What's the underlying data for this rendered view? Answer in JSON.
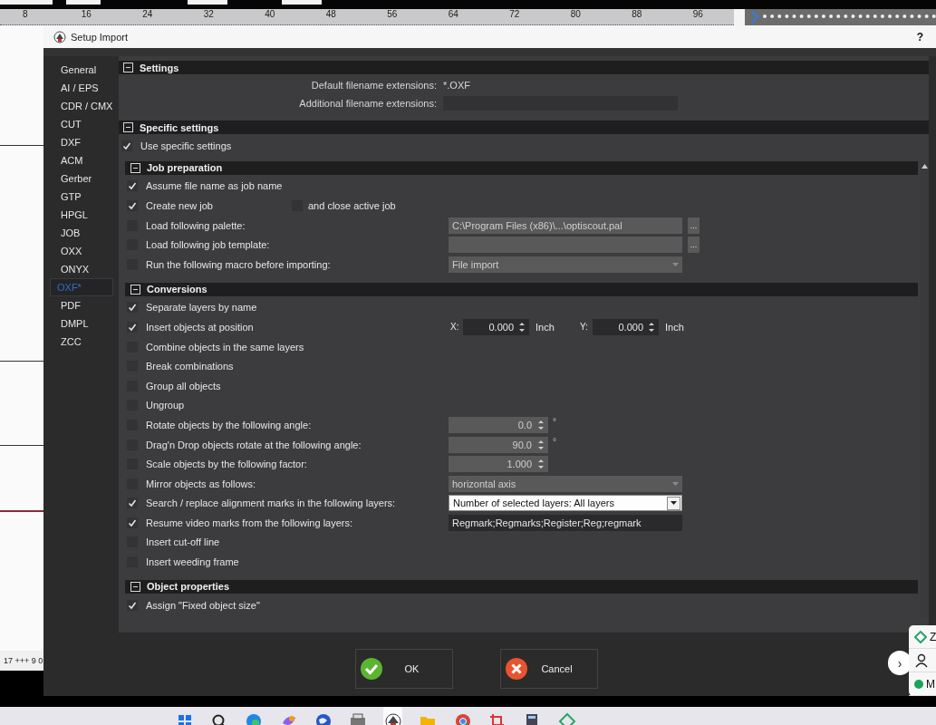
{
  "app": {
    "ruler_labels": [
      "8",
      "16",
      "24",
      "32",
      "40",
      "48",
      "56",
      "64",
      "72",
      "80",
      "88",
      "96"
    ],
    "status_text": "17 +++ 9 0"
  },
  "dialog": {
    "title": "Setup Import",
    "help": "?",
    "sidebar": [
      {
        "label": "General",
        "selected": false
      },
      {
        "label": "AI / EPS",
        "selected": false
      },
      {
        "label": "CDR / CMX",
        "selected": false
      },
      {
        "label": "CUT",
        "selected": false
      },
      {
        "label": "DXF",
        "selected": false
      },
      {
        "label": "ACM",
        "selected": false
      },
      {
        "label": "Gerber",
        "selected": false
      },
      {
        "label": "GTP",
        "selected": false
      },
      {
        "label": "HPGL",
        "selected": false
      },
      {
        "label": "JOB",
        "selected": false
      },
      {
        "label": "OXX",
        "selected": false
      },
      {
        "label": "ONYX",
        "selected": false
      },
      {
        "label": "OXF*",
        "selected": true
      },
      {
        "label": "PDF",
        "selected": false
      },
      {
        "label": "DMPL",
        "selected": false
      },
      {
        "label": "ZCC",
        "selected": false
      }
    ],
    "sections": [
      {
        "title": "Settings",
        "expanded": true,
        "rows": [
          {
            "kind": "info",
            "label": "Default filename extensions:",
            "value": "*.OXF"
          },
          {
            "kind": "field",
            "label": "Additional filename extensions:"
          }
        ]
      },
      {
        "title": "Specific settings",
        "expanded": true,
        "rows": [
          {
            "kind": "check",
            "label": "Use specific settings",
            "checked": true
          }
        ],
        "children": [
          {
            "title": "Job preparation",
            "expanded": true,
            "rows": [
              {
                "kind": "check",
                "label": "Assume file name as job name",
                "checked": true
              },
              {
                "kind": "check",
                "label": "Create new job",
                "checked": true,
                "extra": {
                  "label": "and close active job",
                  "checked": false
                }
              },
              {
                "kind": "check",
                "label": "Load following palette:",
                "checked": false,
                "control": {
                  "kind": "path",
                  "value": "C:\\Program Files (x86)\\...\\optiscout.pal",
                  "button": "...",
                  "disabled": true
                }
              },
              {
                "kind": "check",
                "label": "Load following job template:",
                "checked": false,
                "control": {
                  "kind": "path",
                  "button": "...",
                  "disabled": true
                }
              },
              {
                "kind": "check",
                "label": "Run the following macro before importing:",
                "checked": false,
                "control": {
                  "kind": "dropdown",
                  "value": "File import",
                  "disabled": true
                }
              }
            ]
          },
          {
            "title": "Conversions",
            "expanded": true,
            "rows": [
              {
                "kind": "check",
                "label": "Separate layers by name",
                "checked": true
              },
              {
                "kind": "check",
                "label": "Insert objects at position",
                "checked": true,
                "control": {
                  "kind": "xy",
                  "fields": [
                    {
                      "label": "X:",
                      "value": "0.000",
                      "unit": "Inch"
                    },
                    {
                      "label": "Y:",
                      "value": "0.000",
                      "unit": "Inch"
                    }
                  ]
                }
              },
              {
                "kind": "check",
                "label": "Combine objects in the same layers",
                "checked": false
              },
              {
                "kind": "check",
                "label": "Break combinations",
                "checked": false
              },
              {
                "kind": "check",
                "label": "Group all objects",
                "checked": false
              },
              {
                "kind": "check",
                "label": "Ungroup",
                "checked": false
              },
              {
                "kind": "check",
                "label": "Rotate objects by the following angle:",
                "checked": false,
                "control": {
                  "kind": "spin",
                  "value": "0.0",
                  "unit": "°",
                  "disabled": true
                }
              },
              {
                "kind": "check",
                "label": "Drag'n Drop objects rotate at the following angle:",
                "checked": false,
                "control": {
                  "kind": "spin",
                  "value": "90.0",
                  "unit": "°",
                  "disabled": true
                }
              },
              {
                "kind": "check",
                "label": "Scale objects by the following factor:",
                "checked": false,
                "control": {
                  "kind": "spin",
                  "value": "1.000",
                  "disabled": true
                }
              },
              {
                "kind": "check",
                "label": "Mirror objects as follows:",
                "checked": false,
                "control": {
                  "kind": "dropdown",
                  "value": "horizontal axis",
                  "disabled": true
                }
              },
              {
                "kind": "check",
                "label": "Search / replace alignment marks in the following layers:",
                "checked": true,
                "control": {
                  "kind": "dropdown",
                  "value": "Number of selected layers: All layers",
                  "disabled": false
                }
              },
              {
                "kind": "check",
                "label": "Resume video marks from the following layers:",
                "checked": true,
                "control": {
                  "kind": "text",
                  "value": "Regmark;Regmarks;Register;Reg;regmark",
                  "disabled": false
                }
              },
              {
                "kind": "check",
                "label": "Insert cut-off line",
                "checked": false
              },
              {
                "kind": "check",
                "label": "Insert weeding frame",
                "checked": false
              }
            ]
          },
          {
            "title": "Object properties",
            "expanded": true,
            "rows": [
              {
                "kind": "check",
                "label": "Assign \"Fixed object size\"",
                "checked": true
              }
            ]
          }
        ]
      }
    ],
    "buttons": [
      {
        "label": "OK",
        "kind": "ok"
      },
      {
        "label": "Cancel",
        "kind": "cancel"
      }
    ]
  },
  "side_widget": {
    "toggle": "›",
    "letters": [
      "Z",
      "M"
    ]
  },
  "taskbar": {
    "apps": [
      {
        "kind": "grid",
        "selected": false
      },
      {
        "kind": "search",
        "selected": false
      },
      {
        "kind": "swirl",
        "selected": false
      },
      {
        "kind": "ribbon",
        "selected": false
      },
      {
        "kind": "globe",
        "selected": false
      },
      {
        "kind": "printer",
        "selected": false
      },
      {
        "kind": "emblem",
        "selected": true
      },
      {
        "kind": "folder",
        "selected": false
      },
      {
        "kind": "wheel",
        "selected": false
      },
      {
        "kind": "crop",
        "selected": false
      },
      {
        "kind": "calculator",
        "selected": false
      },
      {
        "kind": "diamond",
        "selected": false
      }
    ]
  }
}
